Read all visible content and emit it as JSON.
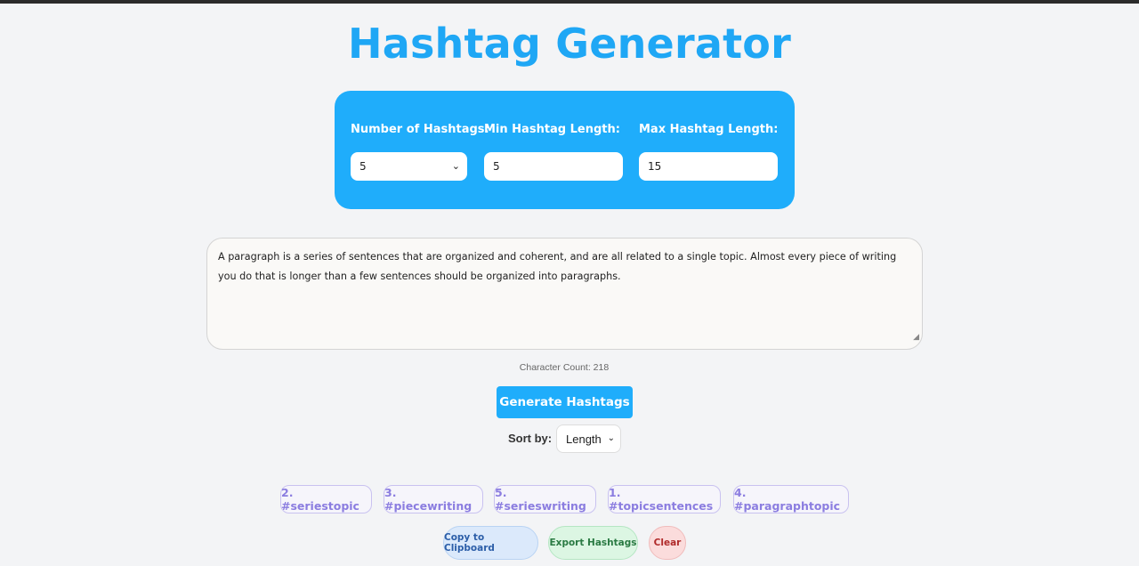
{
  "title": "Hashtag Generator",
  "settings": {
    "num_label": "Number of Hashtags:",
    "num_value": "5",
    "min_label": "Min Hashtag Length:",
    "min_value": "5",
    "max_label": "Max Hashtag Length:",
    "max_value": "15"
  },
  "input_text": "A paragraph is a series of sentences that are organized and coherent, and are all related to a single topic. Almost every piece of writing you do that is longer than a few sentences should be organized into paragraphs.",
  "char_count": "Character Count: 218",
  "generate_label": "Generate Hashtags",
  "sort": {
    "label": "Sort by:",
    "value": "Length"
  },
  "hashtags": [
    "2. #seriestopic",
    "3. #piecewriting",
    "5. #serieswriting",
    "1. #topicsentences",
    "4. #paragraphtopic"
  ],
  "actions": {
    "copy": "Copy to Clipboard",
    "export": "Export Hashtags",
    "clear": "Clear"
  },
  "colors": {
    "accent": "#1fadfb",
    "tag_text": "#8b7de0",
    "copy_bg": "#dbe9fb",
    "export_bg": "#dcf6e3",
    "clear_bg": "#fbdcdc"
  }
}
